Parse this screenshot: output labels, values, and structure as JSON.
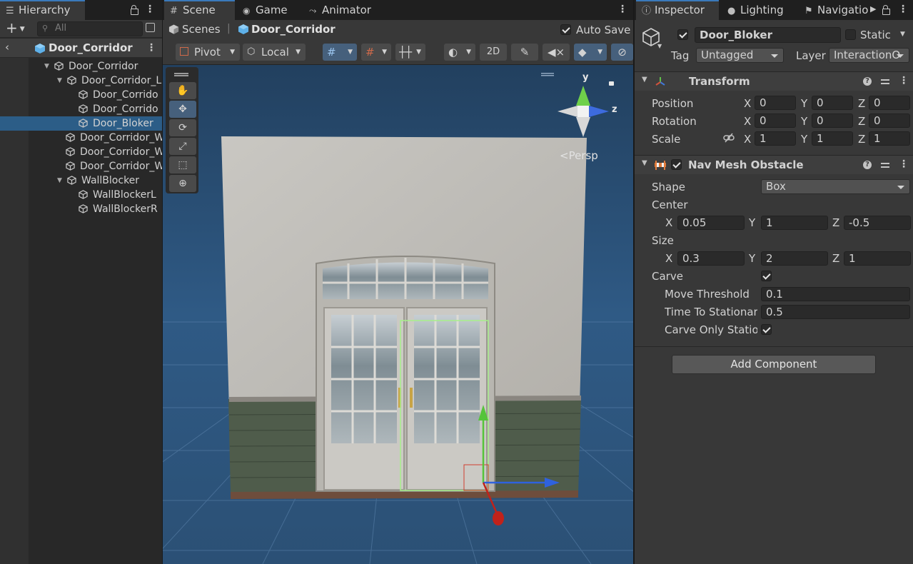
{
  "hierarchy": {
    "tab_label": "Hierarchy",
    "search_placeholder": "All",
    "add_label": "+",
    "scene_name": "Door_Corridor",
    "items": [
      {
        "label": "Door_Corridor"
      },
      {
        "label": "Door_Corridor_L"
      },
      {
        "label": "Door_Corrido"
      },
      {
        "label": "Door_Corrido"
      },
      {
        "label": "Door_Bloker"
      },
      {
        "label": "Door_Corridor_W"
      },
      {
        "label": "Door_Corridor_W"
      },
      {
        "label": "Door_Corridor_W"
      },
      {
        "label": "WallBlocker"
      },
      {
        "label": "WallBlockerL"
      },
      {
        "label": "WallBlockerR"
      }
    ]
  },
  "scene": {
    "tabs": [
      "Scene",
      "Game",
      "Animator"
    ],
    "breadcrumb_root": "Scenes",
    "breadcrumb_current": "Door_Corridor",
    "auto_save_label": "Auto Save",
    "pivot_label": "Pivot",
    "local_label": "Local",
    "mode_2d_label": "2D",
    "gizmo_y": "y",
    "gizmo_z": "z",
    "persp_label": "<Persp"
  },
  "inspector": {
    "tabs": [
      "Inspector",
      "Lighting",
      "Navigatio"
    ],
    "object_name": "Door_Bloker",
    "static_label": "Static",
    "tag_label": "Tag",
    "tag_value": "Untagged",
    "layer_label": "Layer",
    "layer_value": "InteractionO",
    "transform": {
      "title": "Transform",
      "position_label": "Position",
      "rotation_label": "Rotation",
      "scale_label": "Scale",
      "position": [
        "0",
        "0",
        "0"
      ],
      "rotation": [
        "0",
        "0",
        "0"
      ],
      "scale": [
        "1",
        "1",
        "1"
      ],
      "axes": [
        "X",
        "Y",
        "Z"
      ]
    },
    "navmesh": {
      "title": "Nav Mesh Obstacle",
      "shape_label": "Shape",
      "shape_value": "Box",
      "center_label": "Center",
      "center": [
        "0.05",
        "1",
        "-0.5"
      ],
      "size_label": "Size",
      "size": [
        "0.3",
        "2",
        "1"
      ],
      "carve_label": "Carve",
      "move_threshold_label": "Move Threshold",
      "move_threshold_value": "0.1",
      "time_to_stationary_label": "Time To Stationar",
      "time_to_stationary_value": "0.5",
      "carve_only_stationary_label": "Carve Only Station"
    },
    "add_component_label": "Add Component"
  },
  "colors": {
    "selection": "#2c5d87",
    "accent_tab": "#3a79bb",
    "viewport_sky": "#284868",
    "gizmo_x": "#c83a2a",
    "gizmo_y": "#6fd04a",
    "gizmo_z": "#3d6bde"
  }
}
